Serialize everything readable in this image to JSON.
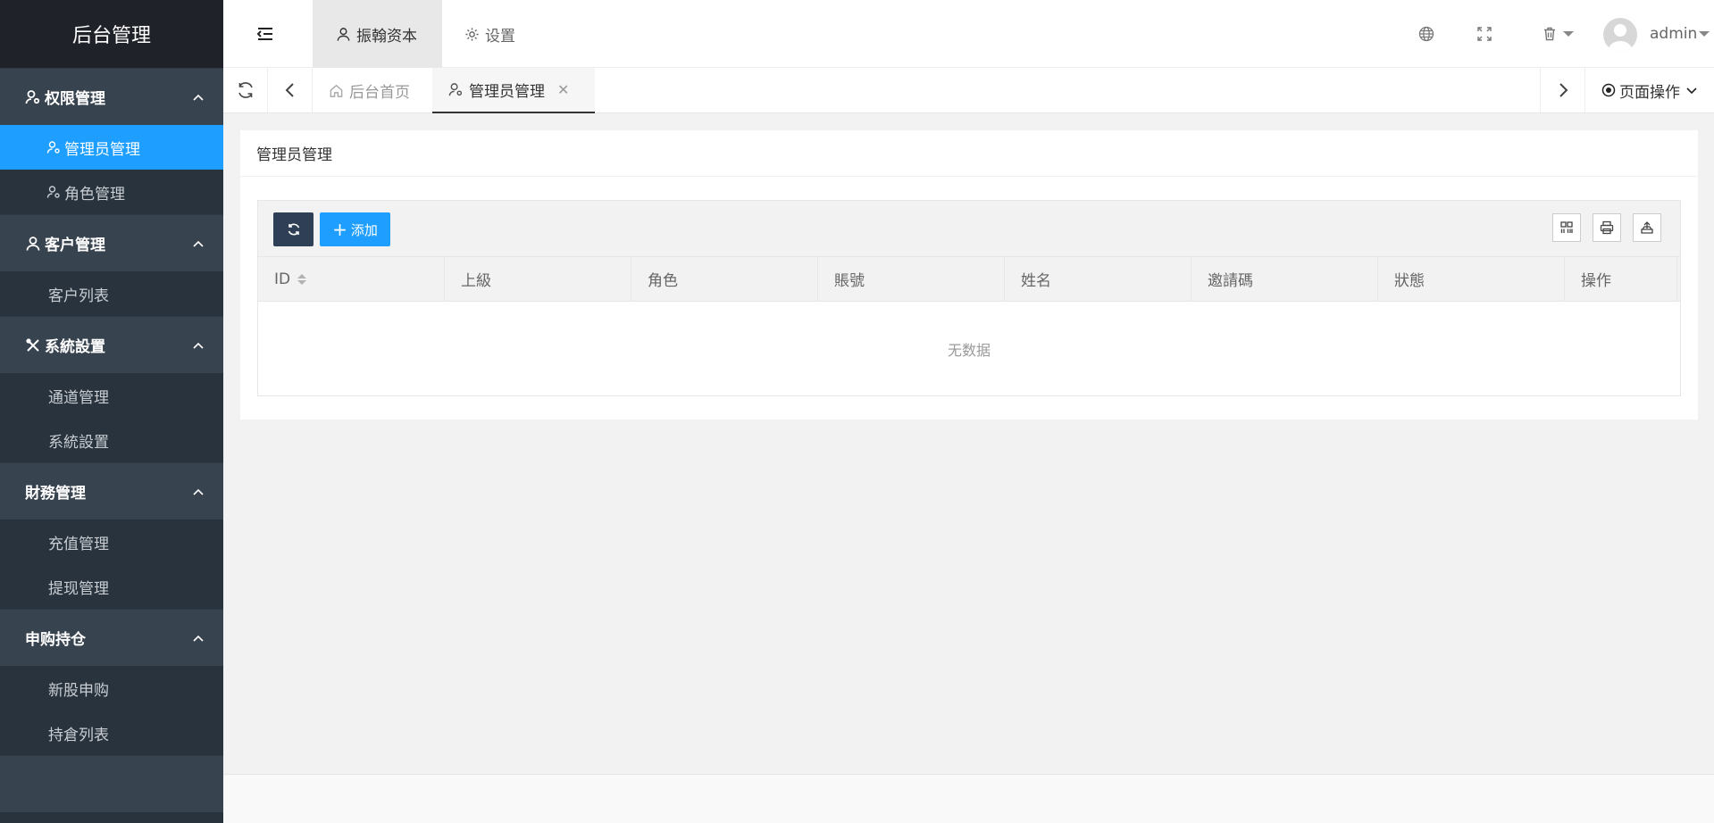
{
  "app": {
    "title": "后台管理"
  },
  "sidebar": {
    "groups": [
      {
        "label": "权限管理",
        "icon": "user-gear-icon",
        "items": [
          {
            "label": "管理员管理",
            "active": true,
            "icon": "user-gear-icon"
          },
          {
            "label": "角色管理",
            "active": false,
            "icon": "user-gear-icon"
          }
        ]
      },
      {
        "label": "客户管理",
        "icon": "user-icon",
        "items": [
          {
            "label": "客户列表"
          }
        ]
      },
      {
        "label": "系統設置",
        "icon": "tools-icon",
        "items": [
          {
            "label": "通道管理"
          },
          {
            "label": "系統設置"
          }
        ]
      },
      {
        "label": "財務管理",
        "items": [
          {
            "label": "充值管理"
          },
          {
            "label": "提现管理"
          }
        ]
      },
      {
        "label": "申购持仓",
        "items": [
          {
            "label": "新股申购"
          },
          {
            "label": "持倉列表"
          }
        ]
      }
    ]
  },
  "header": {
    "tabs": [
      {
        "label": "振翰资本",
        "icon": "user-icon",
        "active": true
      },
      {
        "label": "设置",
        "icon": "gear-icon",
        "active": false
      }
    ],
    "user": {
      "name": "admin"
    }
  },
  "tabbar": {
    "tabs": [
      {
        "label": "后台首页",
        "icon": "home-icon",
        "active": false
      },
      {
        "label": "管理员管理",
        "icon": "user-gear-icon",
        "active": true
      }
    ],
    "close_glyph": "✕",
    "page_ops_label": "页面操作"
  },
  "main": {
    "card_title": "管理员管理",
    "toolbar": {
      "add_label": "添加",
      "add_glyph": "+"
    },
    "table": {
      "columns": [
        "ID",
        "上級",
        "角色",
        "賬號",
        "姓名",
        "邀請碼",
        "狀態",
        "操作"
      ],
      "empty_text": "无数据"
    }
  },
  "colors": {
    "primary": "#1e9fff",
    "sidebar": "#28333e",
    "sidebar_group": "#384350",
    "dark_button": "#2f4056"
  }
}
